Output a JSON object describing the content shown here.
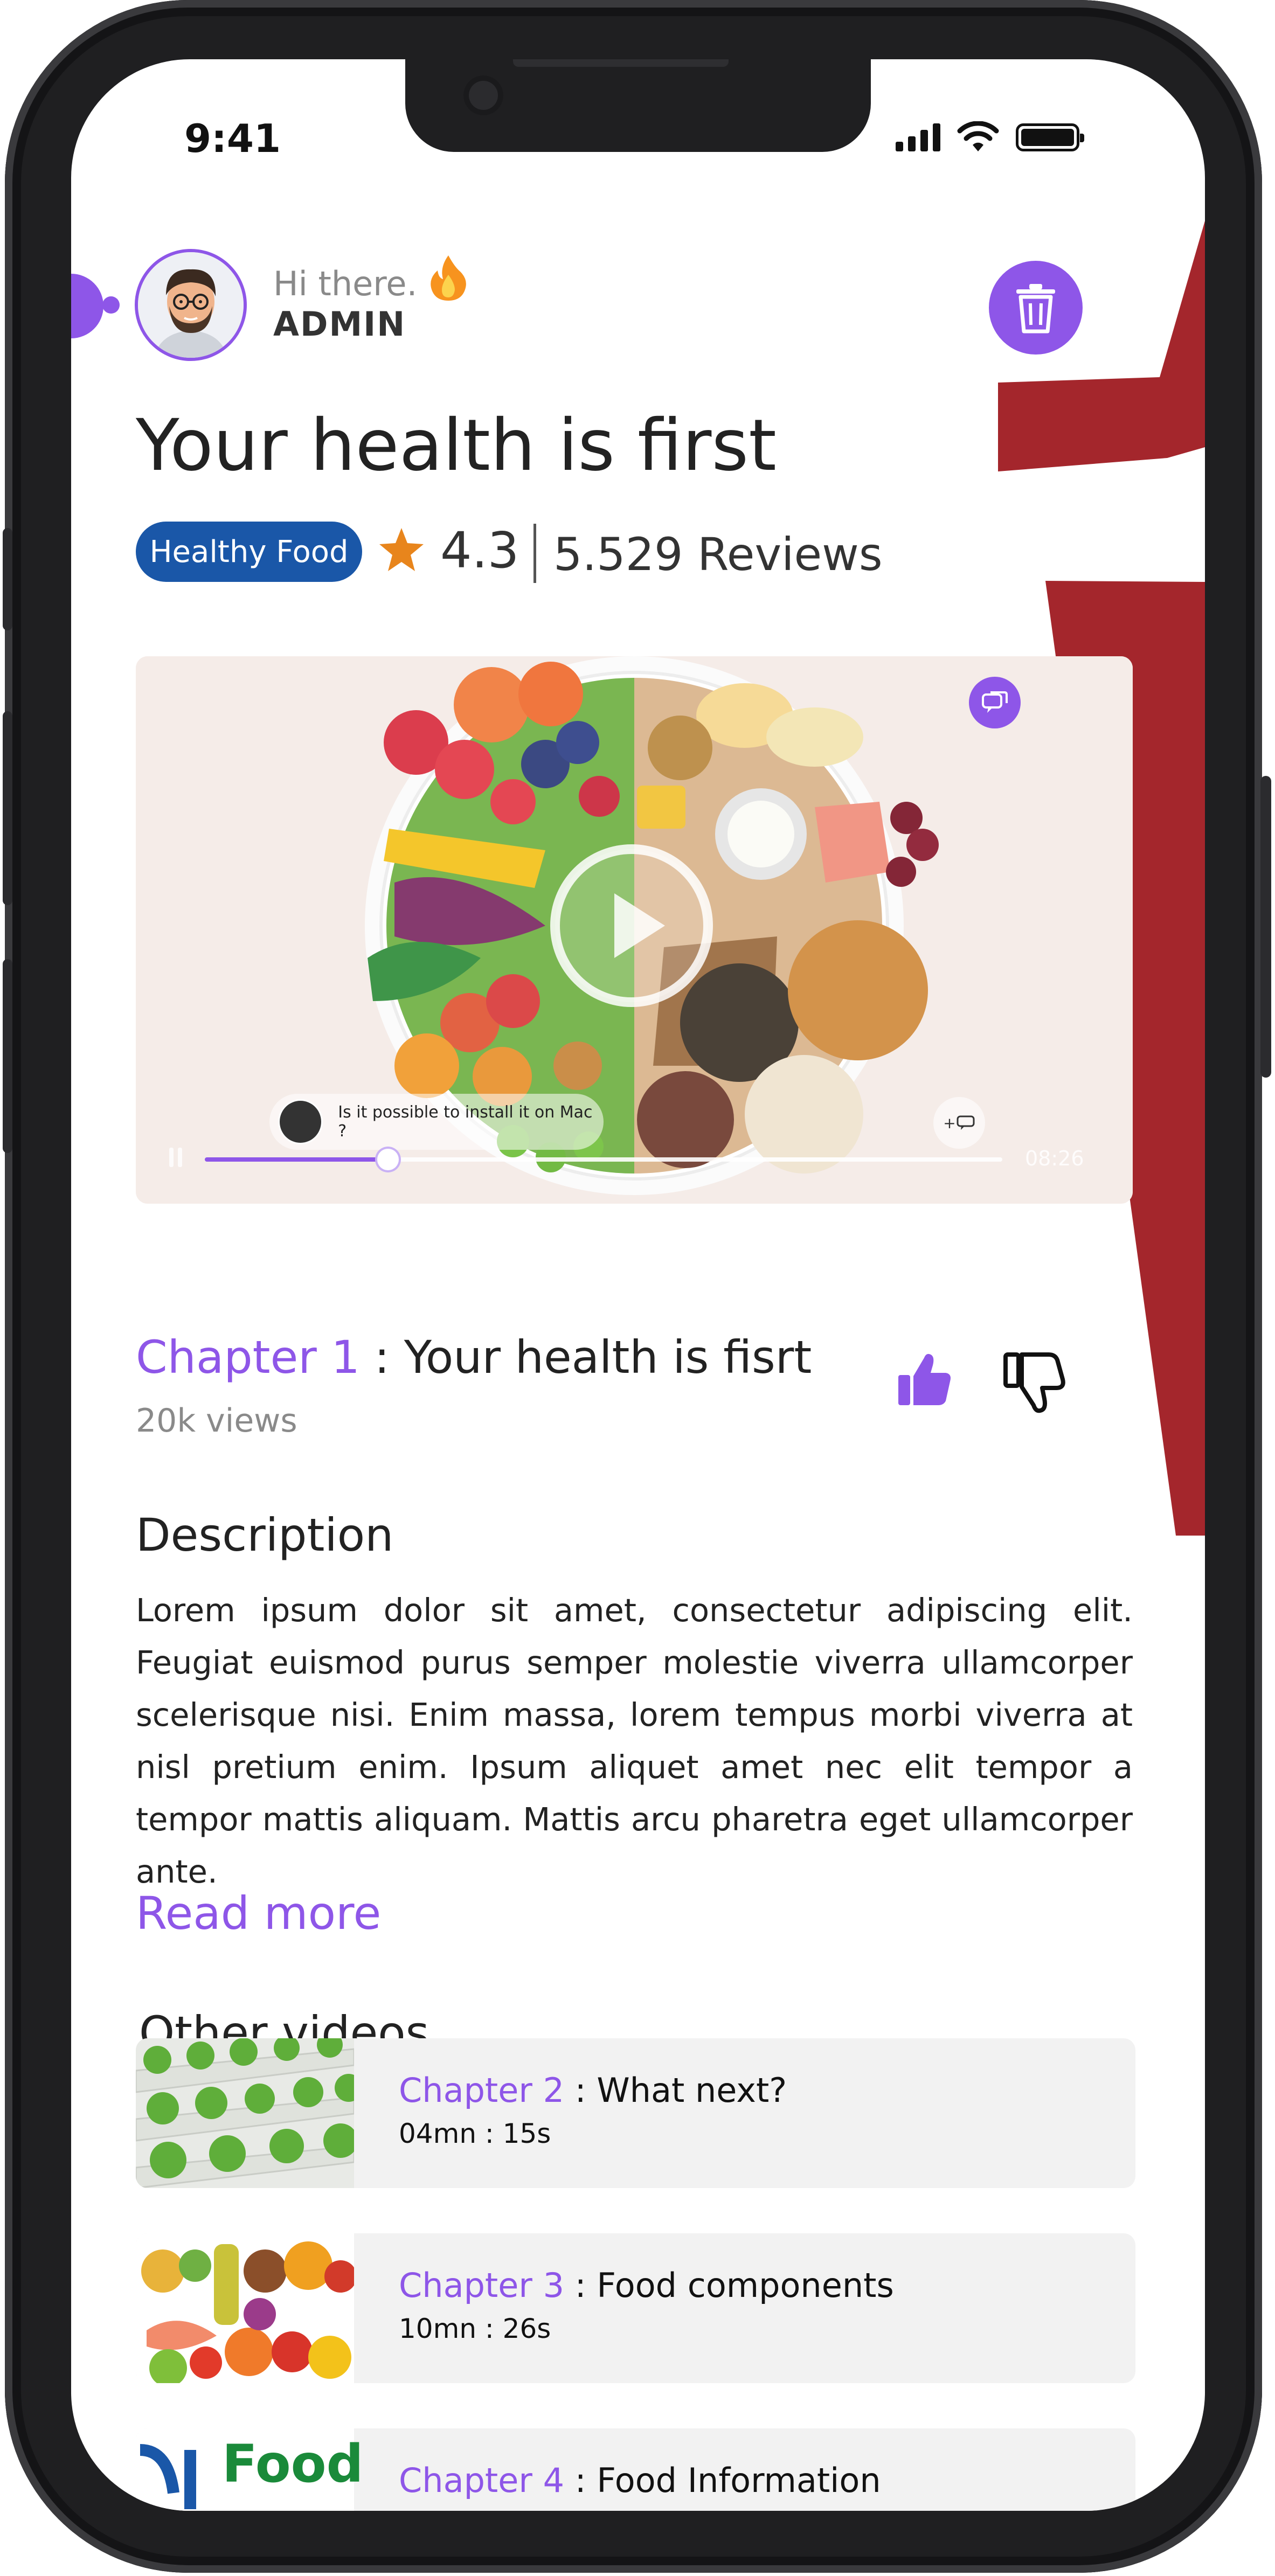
{
  "status_bar": {
    "time": "9:41"
  },
  "header": {
    "greeting": "Hi there.",
    "username": "ADMIN"
  },
  "title": "Your health is first",
  "tag": "Healthy Food",
  "rating": {
    "value": "4.3",
    "reviews": "5.529 Reviews"
  },
  "video": {
    "caption": "Is it possible to install it on Mac ?",
    "caption_add": "+",
    "duration": "08:26",
    "progress": 0.23
  },
  "chapter": {
    "label": "Chapter 1",
    "separator": " :  ",
    "title": "Your health is fisrt",
    "views": "20k views"
  },
  "description": {
    "title": "Description",
    "body": "Lorem ipsum dolor sit amet, consectetur adipiscing elit. Feugiat euismod purus semper molestie viverra ullamcorper scelerisque nisi. Enim massa, lorem tempus morbi viverra at nisl pretium enim. Ipsum aliquet amet nec elit tempor a tempor mattis aliquam. Mattis arcu pharetra eget ullamcorper ante.",
    "read_more": "Read more"
  },
  "other_videos": {
    "title": "Other videos",
    "items": [
      {
        "label": "Chapter 2",
        "title": " : What next?",
        "duration": "04mn : 15s"
      },
      {
        "label": "Chapter 3",
        "title": " : Food components",
        "duration": "10mn : 26s"
      },
      {
        "label": "Chapter 4",
        "title": " : Food Information",
        "duration": "",
        "thumb_text": "Food"
      }
    ]
  },
  "colors": {
    "accent": "#8e56e8",
    "tag": "#1a57a8",
    "decor_red": "#a4262c",
    "star": "#e8851c"
  },
  "icons": [
    "trash-icon",
    "star-icon",
    "play-icon",
    "comment-icon",
    "thumbs-up-icon",
    "thumbs-down-icon",
    "signal-icon",
    "wifi-icon",
    "battery-icon",
    "fire-icon"
  ]
}
